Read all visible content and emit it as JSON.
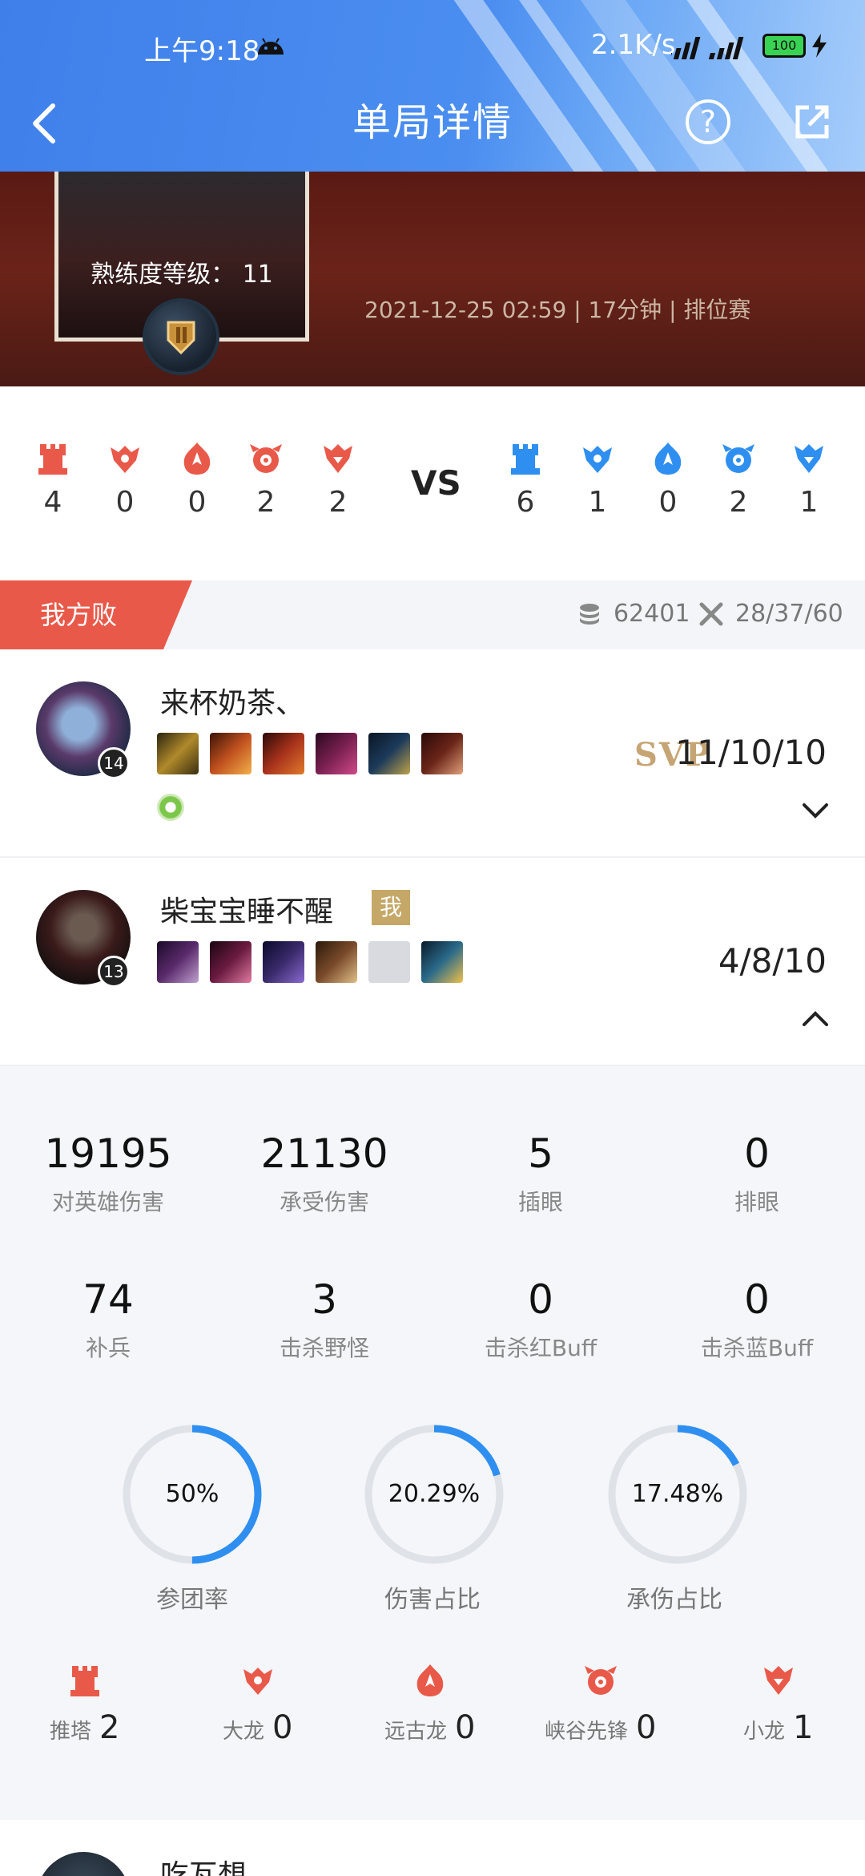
{
  "status_bar": {
    "time": "上午9:18",
    "net_speed": "2.1K/s",
    "battery": "100"
  },
  "nav": {
    "title": "单局详情"
  },
  "hero": {
    "mastery_label": "熟练度等级：",
    "mastery_level": "11",
    "meta": "2021-12-25 02:59 | 17分钟 | 排位赛"
  },
  "objectives_summary": {
    "vs": "VS",
    "left": [
      {
        "icon": "tower-icon",
        "value": "4"
      },
      {
        "icon": "baron-icon",
        "value": "0"
      },
      {
        "icon": "elder-dragon-icon",
        "value": "0"
      },
      {
        "icon": "rift-herald-icon",
        "value": "2"
      },
      {
        "icon": "dragon-icon",
        "value": "2"
      }
    ],
    "right": [
      {
        "icon": "tower-icon",
        "value": "6"
      },
      {
        "icon": "baron-icon",
        "value": "1"
      },
      {
        "icon": "elder-dragon-icon",
        "value": "0"
      },
      {
        "icon": "rift-herald-icon",
        "value": "2"
      },
      {
        "icon": "dragon-icon",
        "value": "1"
      }
    ],
    "colors": {
      "left": "#e9594a",
      "right": "#2f8ff0"
    }
  },
  "team": {
    "result": "我方败",
    "gold": "62401",
    "kda": "28/37/60"
  },
  "players": [
    {
      "name": "来杯奶茶、",
      "level": "14",
      "badge": "SVP",
      "kda": "11/10/10",
      "items": [
        "#b08a2a",
        "#c0501e",
        "#a8321c",
        "#7a2050",
        "#1c3a5a",
        "#6a2418"
      ]
    },
    {
      "name": "柴宝宝睡不醒",
      "level": "13",
      "me_label": "我",
      "kda": "4/8/10",
      "items": [
        "#5a2a6a",
        "#6a1a40",
        "#3a2a6a",
        "#7a4a2a",
        "#d8dadf",
        "#2a6a8a"
      ]
    }
  ],
  "detail": {
    "stats": [
      {
        "value": "19195",
        "label": "对英雄伤害"
      },
      {
        "value": "21130",
        "label": "承受伤害"
      },
      {
        "value": "5",
        "label": "插眼"
      },
      {
        "value": "0",
        "label": "排眼"
      },
      {
        "value": "74",
        "label": "补兵"
      },
      {
        "value": "3",
        "label": "击杀野怪"
      },
      {
        "value": "0",
        "label": "击杀红Buff"
      },
      {
        "value": "0",
        "label": "击杀蓝Buff"
      }
    ],
    "rings": [
      {
        "value": "50%",
        "fraction": 0.5,
        "label": "参团率"
      },
      {
        "value": "20.29%",
        "fraction": 0.2029,
        "label": "伤害占比"
      },
      {
        "value": "17.48%",
        "fraction": 0.1748,
        "label": "承伤占比"
      }
    ],
    "objectives": [
      {
        "icon": "tower-icon",
        "label": "推塔",
        "value": "2"
      },
      {
        "icon": "baron-icon",
        "label": "大龙",
        "value": "0"
      },
      {
        "icon": "elder-dragon-icon",
        "label": "远古龙",
        "value": "0"
      },
      {
        "icon": "rift-herald-icon",
        "label": "峡谷先锋",
        "value": "0"
      },
      {
        "icon": "dragon-icon",
        "label": "小龙",
        "value": "1"
      }
    ],
    "ring_color": "#2f8ff0"
  },
  "next_player": {
    "name": "吃瓦想"
  }
}
